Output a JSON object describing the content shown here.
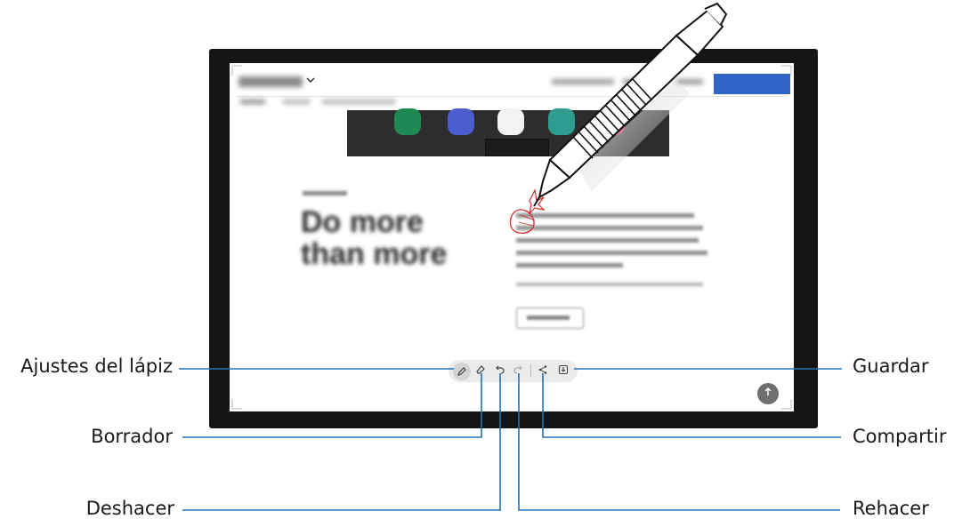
{
  "labels": {
    "pen_settings": "Ajustes del lápiz",
    "eraser": "Borrador",
    "undo": "Deshacer",
    "save": "Guardar",
    "share": "Compartir",
    "redo": "Rehacer"
  },
  "colors": {
    "callout_line": "#1f73b7",
    "cta_button": "#2f63c4",
    "annotation_ink": "#d62a2a"
  },
  "icons": {
    "pen": "pen-icon",
    "eraser": "eraser-icon",
    "undo": "undo-icon",
    "redo": "redo-icon",
    "share": "share-icon",
    "save": "save-icon",
    "scroll_top": "arrow-up-icon"
  }
}
